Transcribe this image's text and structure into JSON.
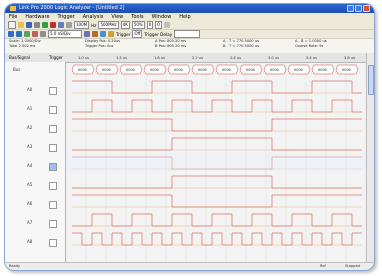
{
  "window": {
    "title": "Link Pro 2000 Logic Analyzer - [Untitled 2]"
  },
  "menu": [
    "File",
    "Hardware",
    "Trigger",
    "Analysis",
    "View",
    "Tools",
    "Window",
    "Help"
  ],
  "toolbar": {
    "sample_rate": "100M",
    "sample_unit": "Hz",
    "memory": "500MHz",
    "depth": "4K",
    "zoom_field": "50%",
    "page_field": "0",
    "cursor_field": "0",
    "time_div": "5.0 nS/Div",
    "trigger_label": "Trigger",
    "trigger_value": "Off",
    "trigger_delay_label": "Trigger Delay"
  },
  "info": {
    "scale": "Scale: 1.0000/Div",
    "total": "Total 2.002 ms",
    "display_pos": "Display Pos: 0.20us",
    "trigger_pos": "Trigger Pos: 0us",
    "a_pos": "A Pos: 805.20 ms",
    "b_pos": "B Pos: 805.20 ms",
    "a_t": "A - T = 770.5000 us",
    "b_t": "B - T = 770.5000 us",
    "a_b": "A - B = 1.0000 us",
    "range": "Coarse Rate: 9s"
  },
  "header": {
    "bus_col": "Bus/Signal",
    "trigger_col": "Trigger"
  },
  "ticks": [
    "1.0 us",
    "1.4 us",
    "1.8 us",
    "2.2 us",
    "2.6 us",
    "3.0 us",
    "3.4 us",
    "3.8 us"
  ],
  "bus": {
    "name": "Bus",
    "values": [
      "0000",
      "0000",
      "0000",
      "0000",
      "0000",
      "0000",
      "0000",
      "000A",
      "0000",
      "0000",
      "0000",
      "0000"
    ]
  },
  "signals": [
    {
      "name": "A0"
    },
    {
      "name": "A1"
    },
    {
      "name": "A2"
    },
    {
      "name": "A3"
    },
    {
      "name": "A4"
    },
    {
      "name": "A5"
    },
    {
      "name": "A6"
    },
    {
      "name": "A7"
    },
    {
      "name": "A8"
    }
  ],
  "status": {
    "left": "Ready",
    "mid": "Ref",
    "right": "Stopped"
  },
  "colors": {
    "accent": "#2b66d1",
    "wave_red": "#d03020",
    "wave_orange": "#e09040",
    "grid": "#cfcfcf"
  }
}
